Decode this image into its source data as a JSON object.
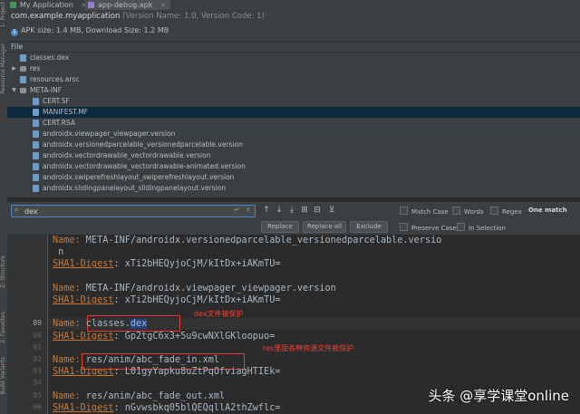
{
  "tabs": [
    {
      "label": "My Application",
      "active": false
    },
    {
      "label": "app-debug.apk",
      "active": true
    }
  ],
  "left_strip": {
    "project": "1: Project",
    "resource_manager": "Resource Manager",
    "structure": "Z: Structure",
    "favorites": "2: Favorites",
    "build_variants": "Build Variants"
  },
  "apk_info": {
    "package": "com.example.myapplication",
    "version": "(Version Name: 1.0, Version Code: 1)",
    "size_text": "APK size: 1.4 MB, Download Size: 1.2 MB"
  },
  "file_header": "File",
  "tree": [
    {
      "label": "classes.dex",
      "depth": 0,
      "kind": "file",
      "expand": ""
    },
    {
      "label": "res",
      "depth": 0,
      "kind": "folder",
      "expand": "▶"
    },
    {
      "label": "resources.arsc",
      "depth": 0,
      "kind": "file",
      "expand": ""
    },
    {
      "label": "META-INF",
      "depth": 0,
      "kind": "folder",
      "expand": "▼"
    },
    {
      "label": "CERT.SF",
      "depth": 1,
      "kind": "file",
      "expand": ""
    },
    {
      "label": "MANIFEST.MF",
      "depth": 1,
      "kind": "file",
      "expand": "",
      "selected": true
    },
    {
      "label": "CERT.RSA",
      "depth": 1,
      "kind": "file",
      "expand": ""
    },
    {
      "label": "androidx.viewpager_viewpager.version",
      "depth": 1,
      "kind": "file",
      "expand": ""
    },
    {
      "label": "androidx.versionedparcelable_versionedparcelable.version",
      "depth": 1,
      "kind": "file",
      "expand": ""
    },
    {
      "label": "androidx.vectordrawable_vectordrawable.version",
      "depth": 1,
      "kind": "file",
      "expand": ""
    },
    {
      "label": "androidx.vectordrawable_vectordrawable-animated.version",
      "depth": 1,
      "kind": "file",
      "expand": ""
    },
    {
      "label": "androidx.swiperefreshlayout_swiperefreshlayout.version",
      "depth": 1,
      "kind": "file",
      "expand": ""
    },
    {
      "label": "androidx.slidingpanelayout_slidingpanelayout.version",
      "depth": 1,
      "kind": "file",
      "expand": ""
    }
  ],
  "find": {
    "query": "dex",
    "match_case": "Match Case",
    "words": "Words",
    "regex": "Regex",
    "match_count": "One match",
    "replace": "Replace",
    "replace_all": "Replace all",
    "exclude": "Exclude",
    "preserve_case": "Preserve Case",
    "in_selection": "In Selection"
  },
  "editor": {
    "lines": [
      {
        "num": "",
        "key": "Name:",
        "val": " META-INF/androidx.versionedparcelable_versionedparcelable.versio",
        "underline": false
      },
      {
        "num": "",
        "key": "",
        "val": " n",
        "underline": false
      },
      {
        "num": "",
        "key": "SHA1-Digest",
        "val": ": xTi2bHEQyjoCjM/kItDx+iAKmTU=",
        "underline": true
      },
      {
        "num": "",
        "key": "",
        "val": "",
        "underline": false
      },
      {
        "num": "",
        "key": "Name:",
        "val": " META-INF/androidx.viewpager_viewpager.version",
        "underline": false
      },
      {
        "num": "",
        "key": "SHA1-Digest",
        "val": ": xTi2bHEQyjoCjM/kItDx+iAKmTU=",
        "underline": true
      },
      {
        "num": "",
        "key": "",
        "val": "",
        "underline": false
      },
      {
        "num": "89",
        "key": "Name:",
        "val": " classes.dex",
        "underline": false
      },
      {
        "num": "90",
        "key": "SHA1-Digest",
        "val": ": Gp2tgC6x3+5u9cwNXlGKloopuo=",
        "underline": true
      },
      {
        "num": "91",
        "key": "",
        "val": "",
        "underline": false
      },
      {
        "num": "92",
        "key": "Name:",
        "val": " res/anim/abc_fade_in.xml",
        "underline": false
      },
      {
        "num": "93",
        "key": "SHA1-Digest",
        "val": ": L01gyYapku8uZtPqOfviagHTIEk=",
        "underline": true
      },
      {
        "num": "94",
        "key": "",
        "val": "",
        "underline": false
      },
      {
        "num": "95",
        "key": "Name:",
        "val": " res/anim/abc_fade_out.xml",
        "underline": false
      },
      {
        "num": "96",
        "key": "SHA1-Digest",
        "val": ": nGvwsbkq05blQEQqllA2thZwflc=",
        "underline": true
      }
    ],
    "annotation_1": "dex文件被保护",
    "annotation_2": "res里面各种资源文件被保护"
  },
  "watermark": "头条 @享学课堂online"
}
